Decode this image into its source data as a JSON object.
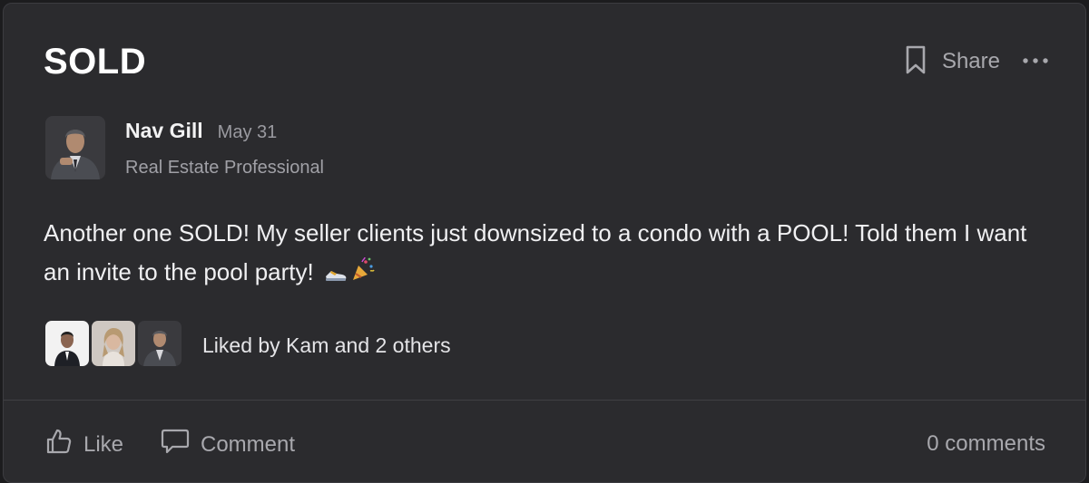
{
  "post": {
    "title": "SOLD",
    "share_label": "Share",
    "author": {
      "name": "Nav Gill",
      "date": "May 31",
      "role": "Real Estate Professional"
    },
    "body": "Another one SOLD! My seller clients just downsized to a condo with a POOL! Told them I want an invite to the pool party!",
    "body_emojis": [
      "sneaker-icon",
      "party-popper-icon"
    ],
    "liked_by": "Liked by Kam and 2 others",
    "liker_avatars": [
      "avatar-man-dark-suit",
      "avatar-woman-blonde",
      "avatar-nav-gill"
    ]
  },
  "footer": {
    "like_label": "Like",
    "comment_label": "Comment",
    "comments_count": "0 comments"
  },
  "colors": {
    "card_background": "#2b2b2e",
    "page_background": "#1c1c1e",
    "text_primary": "#f0f0f2",
    "text_secondary": "#a8a8ad"
  }
}
